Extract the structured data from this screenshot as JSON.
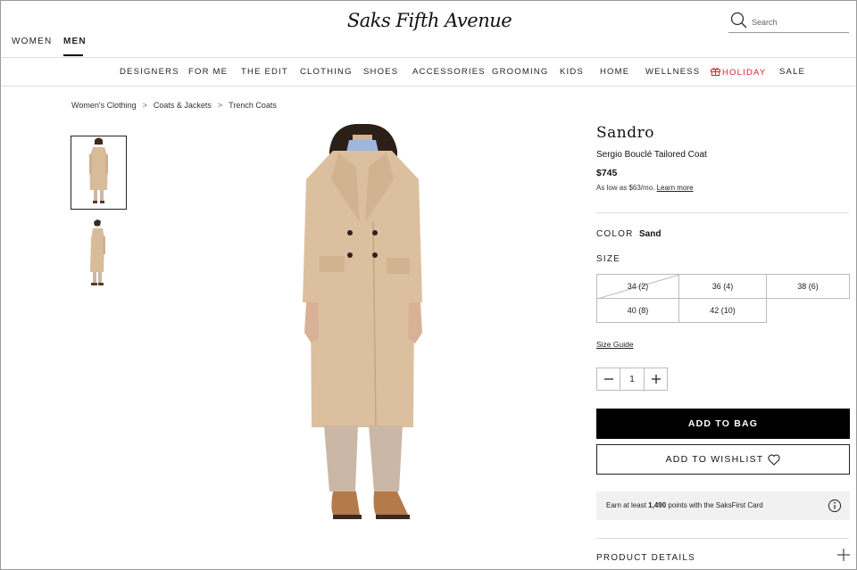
{
  "header": {
    "gender_tabs": [
      {
        "label": "WOMEN",
        "active": false
      },
      {
        "label": "MEN",
        "active": true
      }
    ],
    "logo_text": "Saks Fifth Avenue",
    "search": {
      "placeholder": "Search",
      "value": "",
      "icon": "search-icon"
    }
  },
  "nav": {
    "items": [
      "DESIGNERS",
      "FOR ME",
      "THE EDIT",
      "CLOTHING",
      "SHOES",
      "ACCESSORIES",
      "GROOMING",
      "KIDS",
      "HOME",
      "WELLNESS",
      "HOLIDAY",
      "SALE"
    ],
    "holiday_icon": "gift-icon",
    "holiday_color": "#d6242d"
  },
  "breadcrumb": {
    "items": [
      "Women's Clothing",
      "Coats & Jackets",
      "Trench Coats"
    ],
    "separator": ">"
  },
  "gallery": {
    "thumbnails": [
      {
        "view": "front",
        "selected": true
      },
      {
        "view": "side",
        "selected": false
      }
    ]
  },
  "product": {
    "brand": "Sandro",
    "name": "Sergio Bouclé Tailored Coat",
    "price": "$745",
    "afford_text": "As low as $63/mo.",
    "afford_link": "Learn more",
    "color_label": "COLOR",
    "color_value": "Sand",
    "size_label": "SIZE",
    "sizes": [
      {
        "label": "34 (2)",
        "available": false
      },
      {
        "label": "36 (4)",
        "available": true
      },
      {
        "label": "38 (6)",
        "available": true
      },
      {
        "label": "40 (8)",
        "available": true
      },
      {
        "label": "42 (10)",
        "available": true
      }
    ],
    "size_guide": "Size Guide",
    "quantity": "1",
    "add_to_bag": "ADD TO BAG",
    "add_to_wishlist": "ADD TO WISHLIST",
    "points": {
      "prefix": "Earn at least",
      "amount": "1,490",
      "suffix": "points with the SaksFirst Card"
    },
    "product_details": "PRODUCT DETAILS"
  },
  "colors": {
    "coat": "#dcbf9f",
    "holiday": "#d6242d",
    "button_black": "#000000",
    "points_bg": "#f1f1f1"
  }
}
